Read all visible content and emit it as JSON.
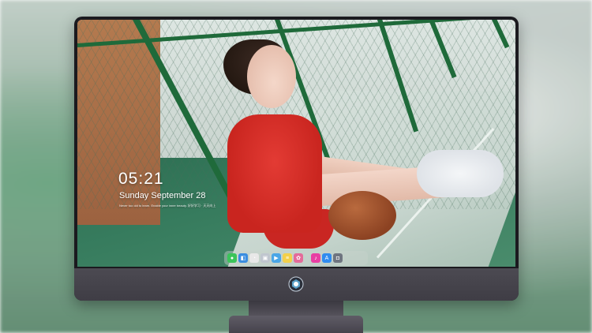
{
  "lockscreen": {
    "time": "05:21",
    "date": "Sunday September  28",
    "tagline": "Never too old to learn. Enable your inner beauty. 好好学习 · 天天向上"
  },
  "dock": {
    "items": [
      {
        "name": "messages-icon",
        "color": "#3bc45a",
        "glyph": "●"
      },
      {
        "name": "finder-icon",
        "color": "#3a8de0",
        "glyph": "◧"
      },
      {
        "name": "clock-icon",
        "color": "#e8e8e8",
        "glyph": "◔"
      },
      {
        "name": "preview-icon",
        "color": "#c0c6cf",
        "glyph": "▣"
      },
      {
        "name": "video-icon",
        "color": "#4aa6e6",
        "glyph": "▶"
      },
      {
        "name": "notes-icon",
        "color": "#f3d04a",
        "glyph": "≡"
      },
      {
        "name": "photos-icon",
        "color": "#e46b9a",
        "glyph": "✿"
      },
      {
        "name": "music-icon",
        "color": "#e83fa3",
        "glyph": "♪"
      },
      {
        "name": "app-store-icon",
        "color": "#2f8cf0",
        "glyph": "A"
      },
      {
        "name": "screenshot-icon",
        "color": "#6f7580",
        "glyph": "◘"
      }
    ]
  },
  "monitor": {
    "logo_icon": "brand-emblem-icon"
  }
}
